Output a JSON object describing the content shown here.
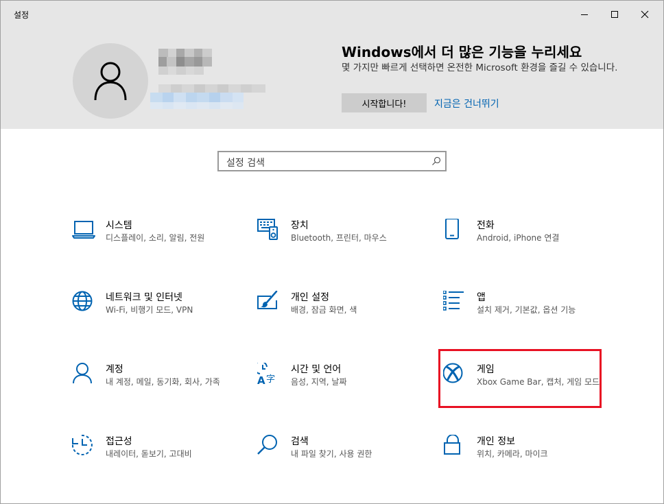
{
  "window": {
    "title": "설정"
  },
  "hero": {
    "promo_title": "Windows에서 더 많은 기능을 누리세요",
    "promo_desc": "몇 가지만 빠르게 선택하면 온전한 Microsoft 환경을 즐길 수 있습니다.",
    "start_button": "시작합니다!",
    "skip_link": "지금은 건너뛰기"
  },
  "search": {
    "placeholder": "설정 검색",
    "icon": "search-icon"
  },
  "tiles": [
    {
      "name": "시스템",
      "desc": "디스플레이, 소리, 알림, 전원",
      "icon": "laptop-icon"
    },
    {
      "name": "장치",
      "desc": "Bluetooth, 프린터, 마우스",
      "icon": "devices-icon"
    },
    {
      "name": "전화",
      "desc": "Android, iPhone 연결",
      "icon": "phone-icon"
    },
    {
      "name": "네트워크 및 인터넷",
      "desc": "Wi-Fi, 비행기 모드, VPN",
      "icon": "globe-icon"
    },
    {
      "name": "개인 설정",
      "desc": "배경, 잠금 화면, 색",
      "icon": "personalization-icon"
    },
    {
      "name": "앱",
      "desc": "설치 제거, 기본값, 옵션 기능",
      "icon": "apps-list-icon"
    },
    {
      "name": "계정",
      "desc": "내 계정, 메일, 동기화, 회사, 가족",
      "icon": "person-icon"
    },
    {
      "name": "시간 및 언어",
      "desc": "음성, 지역, 날짜",
      "icon": "time-language-icon"
    },
    {
      "name": "게임",
      "desc": "Xbox Game Bar, 캡처, 게임 모드",
      "icon": "xbox-icon"
    },
    {
      "name": "접근성",
      "desc": "내레이터, 돋보기, 고대비",
      "icon": "ease-of-access-icon"
    },
    {
      "name": "검색",
      "desc": "내 파일 찾기, 사용 권한",
      "icon": "search-icon"
    },
    {
      "name": "개인 정보",
      "desc": "위치, 카메라, 마이크",
      "icon": "lock-icon"
    }
  ],
  "colors": {
    "accent": "#0063b1",
    "highlight": "#e81123",
    "header_bg": "#e6e6e6"
  }
}
